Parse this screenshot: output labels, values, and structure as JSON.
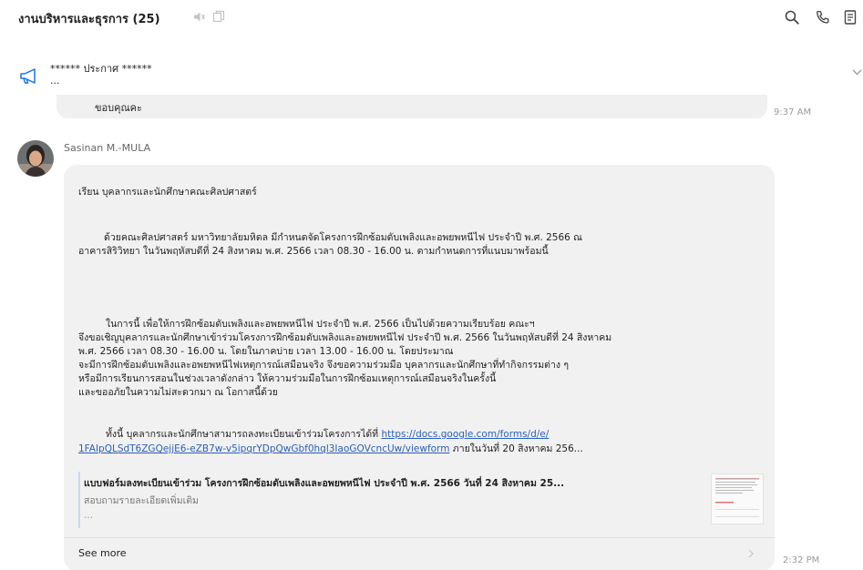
{
  "header": {
    "title": "งานบริหารและธุรการ (25)"
  },
  "announcement": {
    "title": "****** ประกาศ ******",
    "subtitle": "..."
  },
  "previous_message": {
    "text": "ขอบคุณคะ",
    "time": "9:37 AM"
  },
  "message": {
    "sender": "Sasinan M.-MULA",
    "greeting": "เรียน  บุคลากรและนักศึกษาคณะศิลปศาสตร์",
    "para1_l1": "ด้วยคณะศิลปศาสตร์ มหาวิทยาลัยมหิดล มีกำหนดจัดโครงการฝึกซ้อมดับเพลิงและอพยพหนีไฟ ประจำปี พ.ศ. 2566 ณ",
    "para1_l2": "อาคารสิริวิทยา  ในวันพฤหัสบดีที่ 24 สิงหาคม พ.ศ. 2566 เวลา 08.30 - 16.00 น. ตามกำหนดการที่แนบมาพร้อมนี้",
    "para2_l1": "ในการนี้ เพื่อให้การฝึกซ้อมดับเพลิงและอพยพหนีไฟ ประจำปี พ.ศ. 2566 เป็นไปด้วยความเรียบร้อย คณะฯ",
    "para2_l2": "จึงขอเชิญบุคลากรและนักศึกษาเข้าร่วมโครงการฝึกซ้อมดับเพลิงและอพยพหนีไฟ ประจำปี พ.ศ. 2566 ในวันพฤหัสบดีที่ 24 สิงหาคม",
    "para2_l3": "พ.ศ. 2566 เวลา 08.30 - 16.00 น. โดยในภาคบ่าย เวลา 13.00 - 16.00 น. โดยประมาณ",
    "para2_l4": "จะมีการฝึกซ้อมดับเพลิงและอพยพหนีไฟเหตุการณ์เสมือนจริง จึงขอความร่วมมือ บุคลากรและนักศึกษาที่ทำกิจกรรมต่าง ๆ",
    "para2_l5": "หรือมีการเรียนการสอนในช่วงเวลาดังกล่าว ให้ความร่วมมือในการฝึกซ้อมเหตุการณ์เสมือนจริงในครั้งนี้",
    "para2_l6": "และขออภัยในความไม่สะดวกมา ณ โอกาสนี้ด้วย",
    "para3_prefix": "ทั้งนี้ บุคลากรและนักศึกษาสามารถลงทะเบียนเข้าร่วมโครงการได้ที่ ",
    "link_part1": "https://docs.google.com/forms/d/e/",
    "link_part2": "1FAIpQLSdT6ZGQejjE6-eZB7w-v5ipqrYDpQwGbf0hql3IaoGOVcncUw/viewform",
    "para3_suffix": " ภายในวันที่ 20 สิงหาคม 256...",
    "preview_title": "แบบฟอร์มลงทะเบียนเข้าร่วม โครงการฝึกซ้อมดับเพลิงและอพยพหนีไฟ ประจำปี พ.ศ. 2566 วันที่ 24 สิงหาคม 25...",
    "preview_desc": "สอบถามรายละเอียดเพิ่มเติม",
    "preview_ellipsis": "...",
    "see_more": "See more",
    "time": "2:32 PM"
  },
  "colors": {
    "bubble": "#f1f1f1",
    "link": "#2b5fb8",
    "accent": "#1a73e8"
  },
  "icons": [
    "mute-icon",
    "copy-icon",
    "search-icon",
    "phone-icon",
    "notes-icon",
    "megaphone-icon",
    "chevron-down-icon",
    "chevron-right-icon"
  ]
}
